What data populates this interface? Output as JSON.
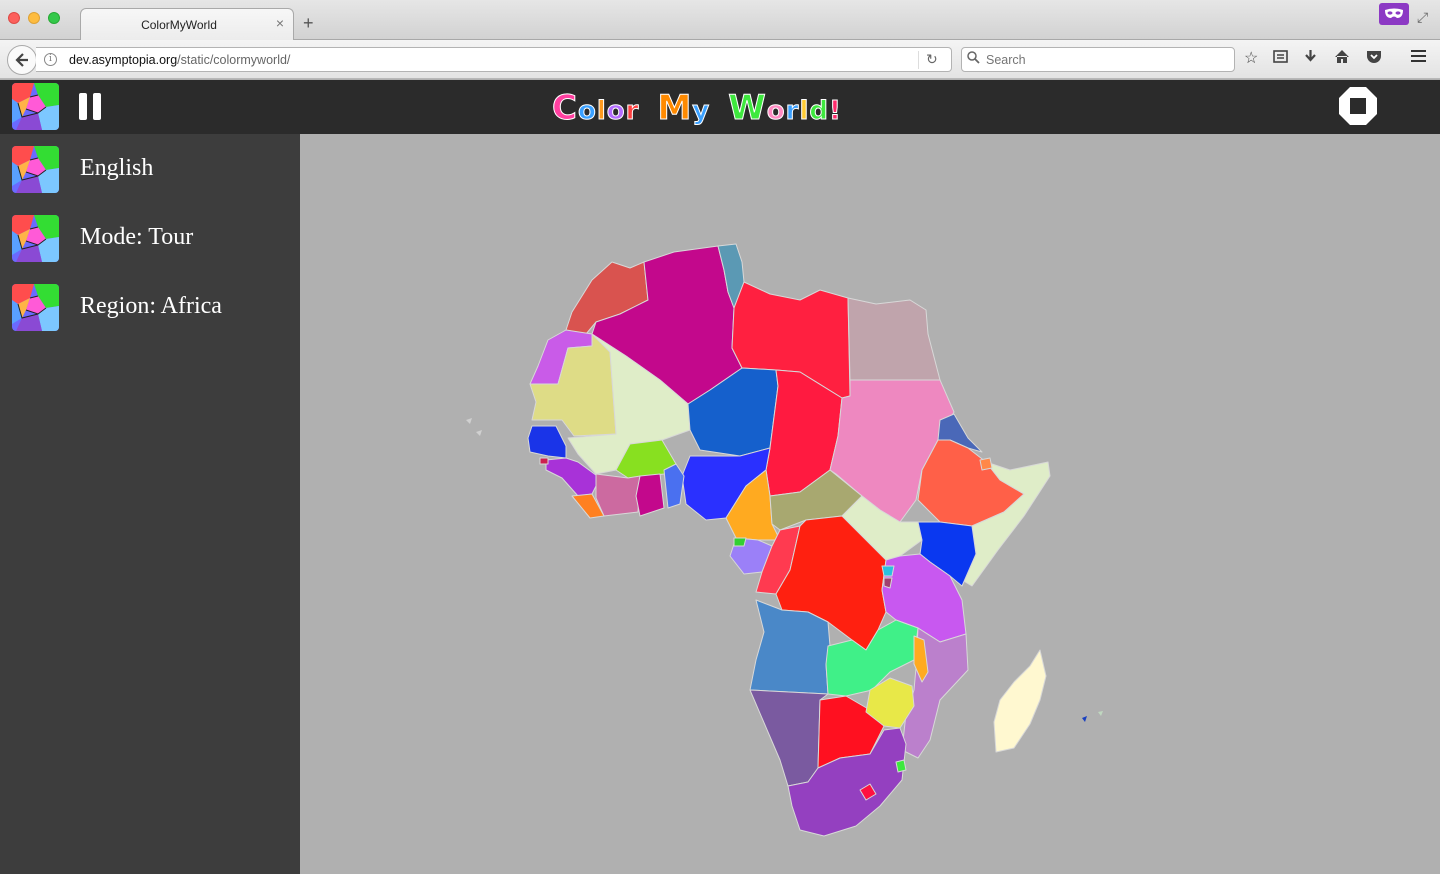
{
  "browser": {
    "tab_title": "ColorMyWorld",
    "new_tab_glyph": "+",
    "close_glyph": "×",
    "url_host": "dev.asymptopia.org",
    "url_path": "/static/colormyworld/",
    "search_placeholder": "Search",
    "icons": [
      "back-icon",
      "info-icon",
      "reload-icon",
      "search-icon",
      "bookmark-star-icon",
      "reading-list-icon",
      "download-icon",
      "home-icon",
      "pocket-icon",
      "hamburger-menu-icon",
      "mask-extension-icon",
      "fullscreen-icon"
    ]
  },
  "app": {
    "title_words": [
      {
        "text": "Color",
        "colors": [
          "#ff3fa0",
          "#3aa0ff",
          "#ff9a1f",
          "#b46cff",
          "#ff4040"
        ]
      },
      {
        "text": "My",
        "colors": [
          "#ff8a00",
          "#3aa0ff"
        ]
      },
      {
        "text": "World!",
        "colors": [
          "#3ee83e",
          "#ff8ac2",
          "#3aa0ff",
          "#ffcc33",
          "#3ee83e",
          "#ff2a6a"
        ]
      }
    ],
    "pause_icon": "pause-icon",
    "stop_icon": "stop-icon"
  },
  "sidebar": {
    "items": [
      {
        "label": "English",
        "icon": "map-thumbnail-icon"
      },
      {
        "label": "Mode: Tour",
        "icon": "map-thumbnail-icon"
      },
      {
        "label": "Region: Africa",
        "icon": "map-thumbnail-icon"
      }
    ],
    "collapse_glyph": "‹"
  },
  "map": {
    "region": "Africa",
    "background": "#b0b0b0",
    "countries": [
      {
        "name": "morocco",
        "color": "#d9534f"
      },
      {
        "name": "western-sahara",
        "color": "#c95be8"
      },
      {
        "name": "algeria",
        "color": "#c3088c"
      },
      {
        "name": "tunisia",
        "color": "#5b99b4"
      },
      {
        "name": "libya",
        "color": "#ff2040"
      },
      {
        "name": "egypt",
        "color": "#c0a4ac"
      },
      {
        "name": "mauritania",
        "color": "#dedc86"
      },
      {
        "name": "mali",
        "color": "#dfedc8"
      },
      {
        "name": "niger",
        "color": "#1560cc"
      },
      {
        "name": "chad",
        "color": "#ff1a40"
      },
      {
        "name": "sudan",
        "color": "#ee88c0"
      },
      {
        "name": "eritrea",
        "color": "#4a68b8"
      },
      {
        "name": "ethiopia",
        "color": "#ff6048"
      },
      {
        "name": "somalia",
        "color": "#dfedc8"
      },
      {
        "name": "senegal",
        "color": "#1a34e8"
      },
      {
        "name": "guinea",
        "color": "#a832d8"
      },
      {
        "name": "burkina-faso",
        "color": "#88e020"
      },
      {
        "name": "ivory-coast",
        "color": "#cc6aa0"
      },
      {
        "name": "ghana",
        "color": "#c3088c"
      },
      {
        "name": "nigeria",
        "color": "#2a30ff"
      },
      {
        "name": "cameroon",
        "color": "#ffaa20"
      },
      {
        "name": "car",
        "color": "#a8a870"
      },
      {
        "name": "south-sudan",
        "color": "#dfedc8"
      },
      {
        "name": "kenya",
        "color": "#0a38f0"
      },
      {
        "name": "gabon",
        "color": "#9b80f8"
      },
      {
        "name": "congo",
        "color": "#ff3a50"
      },
      {
        "name": "drc",
        "color": "#ff2010"
      },
      {
        "name": "tanzania",
        "color": "#c858f0"
      },
      {
        "name": "angola",
        "color": "#4a88c8"
      },
      {
        "name": "zambia",
        "color": "#40f088"
      },
      {
        "name": "mozambique",
        "color": "#bb80cc"
      },
      {
        "name": "namibia",
        "color": "#7a5aa0"
      },
      {
        "name": "botswana",
        "color": "#ff1020"
      },
      {
        "name": "zimbabwe",
        "color": "#e8e848"
      },
      {
        "name": "south-africa",
        "color": "#9440c0"
      },
      {
        "name": "madagascar",
        "color": "#fff8d0"
      }
    ]
  }
}
